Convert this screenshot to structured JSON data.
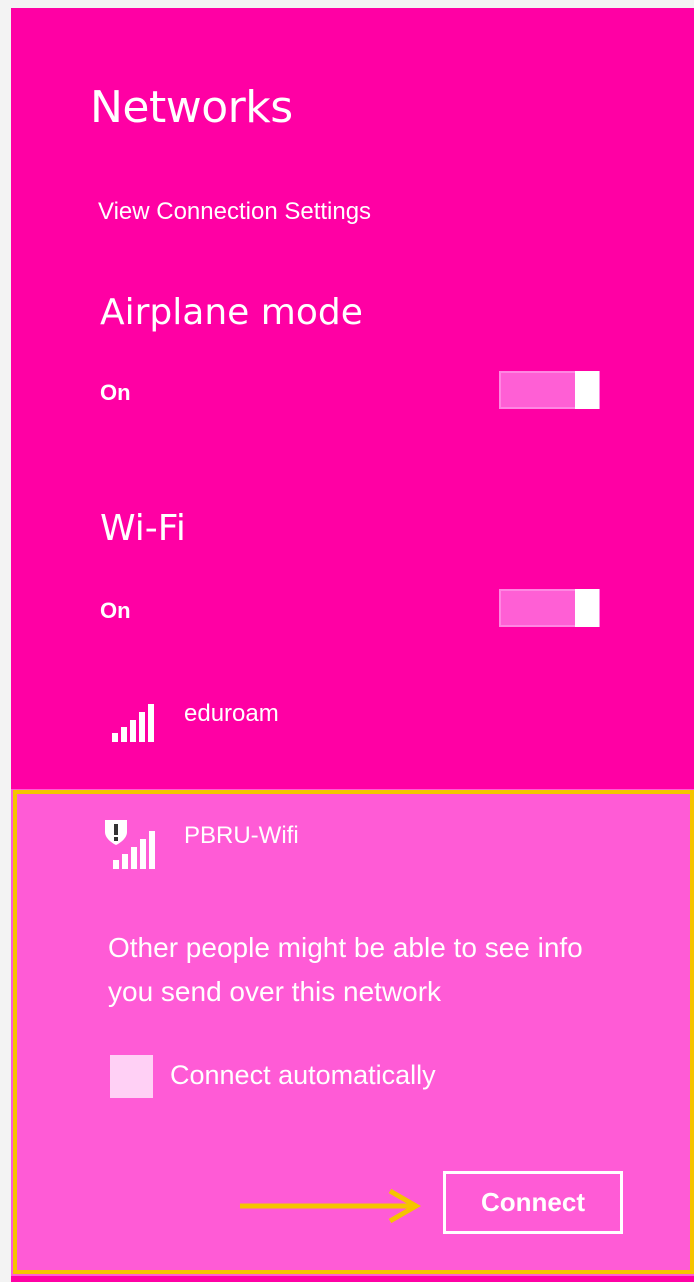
{
  "header": {
    "title": "Networks",
    "view_settings_label": "View Connection Settings"
  },
  "airplane_mode": {
    "title": "Airplane mode",
    "state_label": "On",
    "enabled": true
  },
  "wifi": {
    "title": "Wi-Fi",
    "state_label": "On",
    "enabled": true
  },
  "networks": [
    {
      "name": "eduroam",
      "secured": true,
      "signal_bars": 5
    },
    {
      "name": "PBRU-Wifi",
      "secured": false,
      "signal_bars": 5
    }
  ],
  "expanded_network": {
    "warning": "Other people might be able to see info you send over this network",
    "connect_automatically_label": "Connect automatically",
    "connect_automatically_checked": false,
    "connect_label": "Connect"
  },
  "colors": {
    "accent": "#ff00a4",
    "expanded_background": "#ff5bd6",
    "highlight": "#f5c400",
    "text": "#ffffff"
  },
  "icons": {
    "signal": "wifi-signal-icon",
    "unsecured": "shield-warning-icon",
    "annotation_arrow": "arrow-right-icon"
  }
}
